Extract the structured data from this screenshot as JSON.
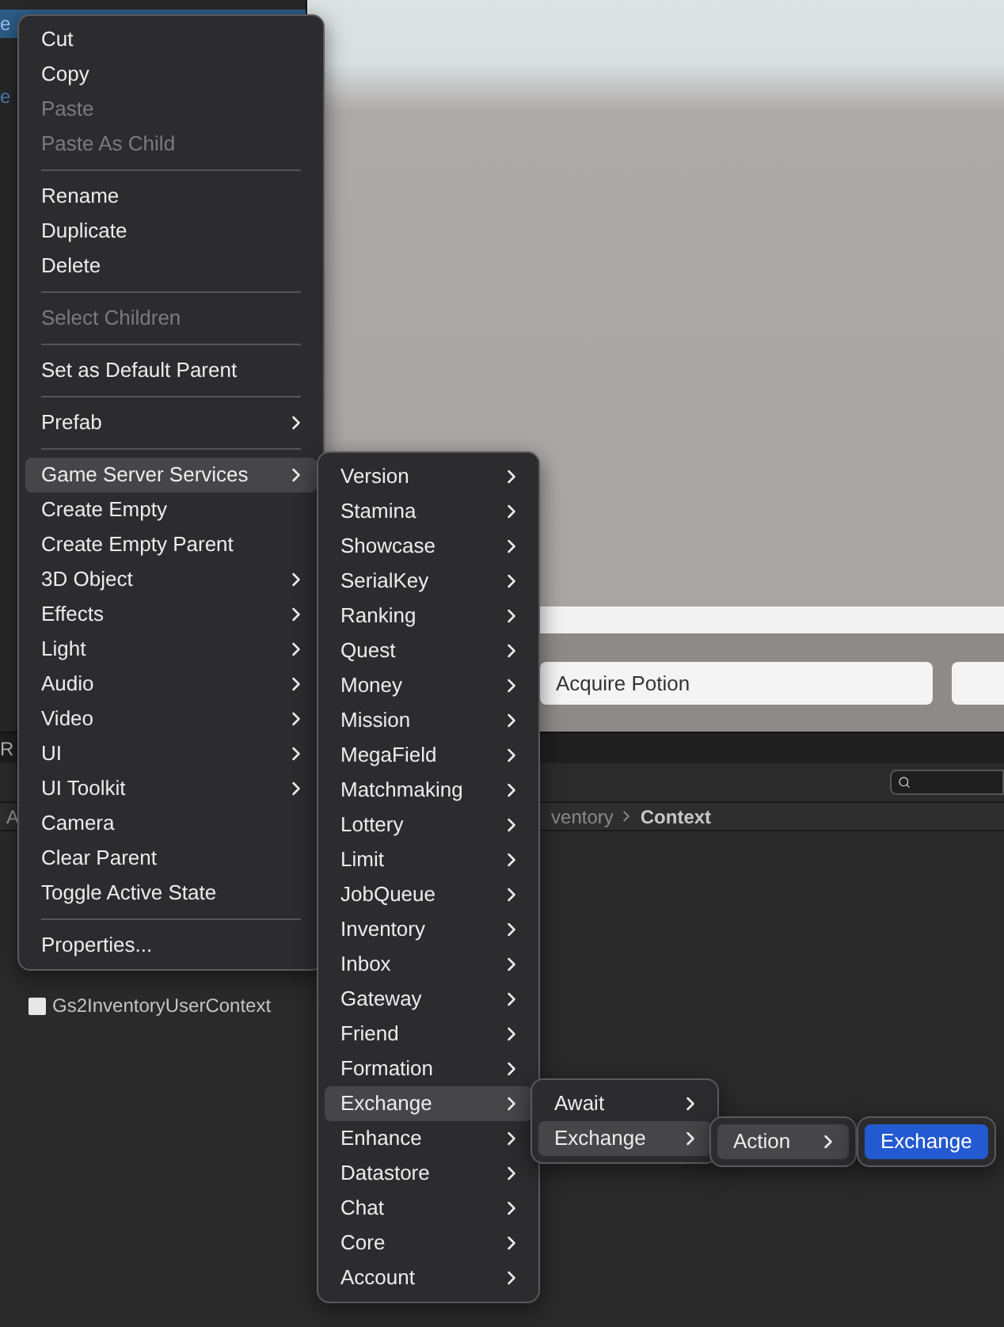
{
  "hierarchy": {
    "items": [
      {
        "label": "e",
        "selected": true
      },
      {
        "label": "e",
        "selected": false
      }
    ]
  },
  "scene_fields": [
    {
      "kind": "field",
      "value": "Acquire Potion"
    },
    {
      "kind": "field"
    }
  ],
  "bottom_panel": {
    "tab": "R",
    "side_label": "A",
    "breadcrumb": [
      {
        "label": "ventory",
        "current": false
      },
      {
        "label": "Context",
        "current": true
      }
    ],
    "files": [
      {
        "label": "Gs2InventoryUserContext"
      }
    ]
  },
  "menus": [
    {
      "items": [
        {
          "kind": "item",
          "label": "Cut",
          "disabled": false,
          "submenu": false,
          "selected": false
        },
        {
          "kind": "item",
          "label": "Copy",
          "disabled": false,
          "submenu": false,
          "selected": false
        },
        {
          "kind": "item",
          "label": "Paste",
          "disabled": true,
          "submenu": false,
          "selected": false
        },
        {
          "kind": "item",
          "label": "Paste As Child",
          "disabled": true,
          "submenu": false,
          "selected": false
        },
        {
          "kind": "separator"
        },
        {
          "kind": "item",
          "label": "Rename",
          "disabled": false,
          "submenu": false,
          "selected": false
        },
        {
          "kind": "item",
          "label": "Duplicate",
          "disabled": false,
          "submenu": false,
          "selected": false
        },
        {
          "kind": "item",
          "label": "Delete",
          "disabled": false,
          "submenu": false,
          "selected": false
        },
        {
          "kind": "separator"
        },
        {
          "kind": "item",
          "label": "Select Children",
          "disabled": true,
          "submenu": false,
          "selected": false
        },
        {
          "kind": "separator"
        },
        {
          "kind": "item",
          "label": "Set as Default Parent",
          "disabled": false,
          "submenu": false,
          "selected": false
        },
        {
          "kind": "separator"
        },
        {
          "kind": "item",
          "label": "Prefab",
          "disabled": false,
          "submenu": true,
          "selected": false
        },
        {
          "kind": "separator"
        },
        {
          "kind": "item",
          "label": "Game Server Services",
          "disabled": false,
          "submenu": true,
          "selected": true
        },
        {
          "kind": "item",
          "label": "Create Empty",
          "disabled": false,
          "submenu": false,
          "selected": false
        },
        {
          "kind": "item",
          "label": "Create Empty Parent",
          "disabled": false,
          "submenu": false,
          "selected": false
        },
        {
          "kind": "item",
          "label": "3D Object",
          "disabled": false,
          "submenu": true,
          "selected": false
        },
        {
          "kind": "item",
          "label": "Effects",
          "disabled": false,
          "submenu": true,
          "selected": false
        },
        {
          "kind": "item",
          "label": "Light",
          "disabled": false,
          "submenu": true,
          "selected": false
        },
        {
          "kind": "item",
          "label": "Audio",
          "disabled": false,
          "submenu": true,
          "selected": false
        },
        {
          "kind": "item",
          "label": "Video",
          "disabled": false,
          "submenu": true,
          "selected": false
        },
        {
          "kind": "item",
          "label": "UI",
          "disabled": false,
          "submenu": true,
          "selected": false
        },
        {
          "kind": "item",
          "label": "UI Toolkit",
          "disabled": false,
          "submenu": true,
          "selected": false
        },
        {
          "kind": "item",
          "label": "Camera",
          "disabled": false,
          "submenu": false,
          "selected": false
        },
        {
          "kind": "item",
          "label": "Clear Parent",
          "disabled": false,
          "submenu": false,
          "selected": false
        },
        {
          "kind": "item",
          "label": "Toggle Active State",
          "disabled": false,
          "submenu": false,
          "selected": false
        },
        {
          "kind": "separator"
        },
        {
          "kind": "item",
          "label": "Properties...",
          "disabled": false,
          "submenu": false,
          "selected": false
        }
      ]
    },
    {
      "items": [
        {
          "kind": "item",
          "label": "Version",
          "disabled": false,
          "submenu": true,
          "selected": false
        },
        {
          "kind": "item",
          "label": "Stamina",
          "disabled": false,
          "submenu": true,
          "selected": false
        },
        {
          "kind": "item",
          "label": "Showcase",
          "disabled": false,
          "submenu": true,
          "selected": false
        },
        {
          "kind": "item",
          "label": "SerialKey",
          "disabled": false,
          "submenu": true,
          "selected": false
        },
        {
          "kind": "item",
          "label": "Ranking",
          "disabled": false,
          "submenu": true,
          "selected": false
        },
        {
          "kind": "item",
          "label": "Quest",
          "disabled": false,
          "submenu": true,
          "selected": false
        },
        {
          "kind": "item",
          "label": "Money",
          "disabled": false,
          "submenu": true,
          "selected": false
        },
        {
          "kind": "item",
          "label": "Mission",
          "disabled": false,
          "submenu": true,
          "selected": false
        },
        {
          "kind": "item",
          "label": "MegaField",
          "disabled": false,
          "submenu": true,
          "selected": false
        },
        {
          "kind": "item",
          "label": "Matchmaking",
          "disabled": false,
          "submenu": true,
          "selected": false
        },
        {
          "kind": "item",
          "label": "Lottery",
          "disabled": false,
          "submenu": true,
          "selected": false
        },
        {
          "kind": "item",
          "label": "Limit",
          "disabled": false,
          "submenu": true,
          "selected": false
        },
        {
          "kind": "item",
          "label": "JobQueue",
          "disabled": false,
          "submenu": true,
          "selected": false
        },
        {
          "kind": "item",
          "label": "Inventory",
          "disabled": false,
          "submenu": true,
          "selected": false
        },
        {
          "kind": "item",
          "label": "Inbox",
          "disabled": false,
          "submenu": true,
          "selected": false
        },
        {
          "kind": "item",
          "label": "Gateway",
          "disabled": false,
          "submenu": true,
          "selected": false
        },
        {
          "kind": "item",
          "label": "Friend",
          "disabled": false,
          "submenu": true,
          "selected": false
        },
        {
          "kind": "item",
          "label": "Formation",
          "disabled": false,
          "submenu": true,
          "selected": false
        },
        {
          "kind": "item",
          "label": "Exchange",
          "disabled": false,
          "submenu": true,
          "selected": true
        },
        {
          "kind": "item",
          "label": "Enhance",
          "disabled": false,
          "submenu": true,
          "selected": false
        },
        {
          "kind": "item",
          "label": "Datastore",
          "disabled": false,
          "submenu": true,
          "selected": false
        },
        {
          "kind": "item",
          "label": "Chat",
          "disabled": false,
          "submenu": true,
          "selected": false
        },
        {
          "kind": "item",
          "label": "Core",
          "disabled": false,
          "submenu": true,
          "selected": false
        },
        {
          "kind": "item",
          "label": "Account",
          "disabled": false,
          "submenu": true,
          "selected": false
        }
      ]
    },
    {
      "items": [
        {
          "kind": "item",
          "label": "Await",
          "disabled": false,
          "submenu": true,
          "selected": false
        },
        {
          "kind": "item",
          "label": "Exchange",
          "disabled": false,
          "submenu": true,
          "selected": true
        }
      ]
    },
    {
      "items": [
        {
          "kind": "item",
          "label": "Action",
          "disabled": false,
          "submenu": true,
          "selected": true
        }
      ]
    },
    {
      "items": [
        {
          "kind": "item",
          "label": "Exchange",
          "disabled": false,
          "submenu": false,
          "selected": true,
          "chosen": true
        }
      ]
    }
  ]
}
